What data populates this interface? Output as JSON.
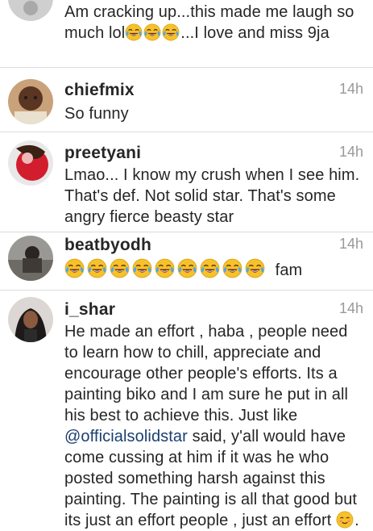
{
  "comments": [
    {
      "username": "",
      "time": "",
      "text_a": "Am cracking up...this made me laugh so much lol",
      "text_b": "...I love and miss 9ja",
      "emoji": "face-with-tears-of-joy"
    },
    {
      "username": "chiefmix",
      "time": "14h",
      "text": "So funny"
    },
    {
      "username": "preetyani",
      "time": "14h",
      "text": "Lmao... I know my crush when I see him. That's def. Not solid star. That's some angry fierce beasty star"
    },
    {
      "username": "beatbyodh",
      "time": "14h",
      "emoji": "face-with-tears-of-joy",
      "emoji_count": 9,
      "text": "fam"
    },
    {
      "username": "i_shar",
      "time": "14h",
      "text_a": "He made an effort , haba , people need to learn how to chill, appreciate and encourage other  people's efforts. Its a painting biko and I am sure he put in all his best to achieve this. Just like ",
      "mention": "@officialsolidstar",
      "text_b": " said, y'all would have come cussing at him if it was he who posted something harsh against this painting. The painting is all that good but its just an effort people , just an effort ",
      "emoji_end": "smiling-face-with-blush",
      "text_c": "."
    }
  ],
  "colors": {
    "username": "#262626",
    "time": "#999999",
    "mention": "#1b3e70",
    "divider": "#dbdbdb"
  }
}
